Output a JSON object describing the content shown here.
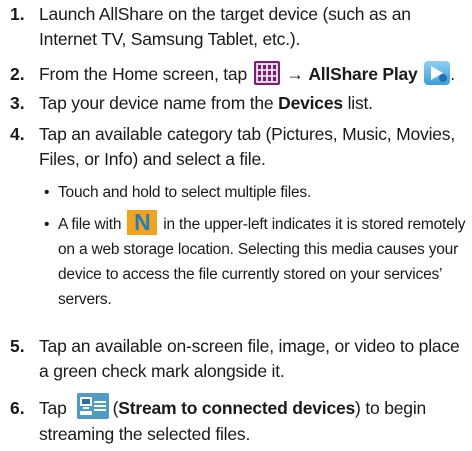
{
  "steps": [
    {
      "num": "1.",
      "text": "Launch AllShare on the target device (such as an Internet TV, Samsung Tablet, etc.)."
    },
    {
      "num": "2.",
      "pre": "From the Home screen, tap",
      "arrow": "→",
      "bold": "AllShare Play",
      "post": "."
    },
    {
      "num": "3.",
      "pre": "Tap your device name from the",
      "bold": "Devices",
      "post": "list."
    },
    {
      "num": "4.",
      "text": "Tap an available category tab (Pictures, Music, Movies, Files, or Info) and select a file."
    },
    {
      "num": "5.",
      "text": "Tap an available on-screen file, image, or video to place a green check mark alongside it."
    },
    {
      "num": "6.",
      "pre": "Tap",
      "open": "(",
      "bold": "Stream to connected devices",
      "close": ")",
      "post": "to begin streaming the selected files."
    }
  ],
  "bullets": [
    {
      "dot": "•",
      "text": "Touch and hold to select multiple files."
    },
    {
      "dot": "•",
      "pre": "A file with",
      "icon_letter": "N",
      "post": "in the upper-left indicates it is stored remotely on a web storage location. Selecting this media causes your device to access the file currently stored on your services’ servers."
    }
  ],
  "icons": {
    "apps": "apps-grid-icon",
    "allshare": "allshare-play-icon",
    "remote": "remote-storage-n-icon",
    "stream": "stream-to-devices-icon"
  },
  "colors": {
    "apps": "#7a1d74",
    "allshare": "#3a9fd8",
    "remote_bg": "#f2a21b",
    "remote_fg": "#1f7fc4",
    "stream": "#4f9bc4"
  }
}
